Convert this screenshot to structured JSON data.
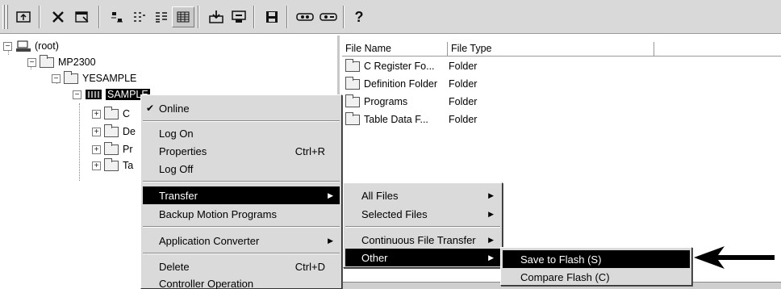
{
  "toolbar": {
    "icons": [
      "up-folder-icon",
      "delete-icon",
      "properties-icon",
      "large-icons-view-icon",
      "small-icons-view-icon",
      "list-view-icon",
      "details-view-icon",
      "download-icon",
      "upload-icon",
      "save-icon",
      "connect-icon",
      "disconnect-icon",
      "help-icon"
    ]
  },
  "tree": {
    "root": "(root)",
    "controller": "MP2300",
    "project": "YESAMPLE",
    "selected": "SAMPLE",
    "children": [
      "C",
      "De",
      "Pr",
      "Ta"
    ]
  },
  "filelist": {
    "columns": [
      "File Name",
      "File Type"
    ],
    "rows": [
      {
        "name": "C Register Fo...",
        "type": "Folder"
      },
      {
        "name": "Definition Folder",
        "type": "Folder"
      },
      {
        "name": "Programs",
        "type": "Folder"
      },
      {
        "name": "Table Data F...",
        "type": "Folder"
      }
    ]
  },
  "context_menu": {
    "online": "Online",
    "log_on": "Log On",
    "properties": "Properties",
    "properties_shortcut": "Ctrl+R",
    "log_off": "Log Off",
    "transfer": "Transfer",
    "backup": "Backup Motion Programs",
    "app_converter": "Application Converter",
    "delete": "Delete",
    "delete_shortcut": "Ctrl+D",
    "controller_op": "Controller Operation"
  },
  "transfer_menu": {
    "all_files": "All Files",
    "selected_files": "Selected Files",
    "continuous": "Continuous File Transfer",
    "other": "Other"
  },
  "other_menu": {
    "save_flash": "Save to Flash (S)",
    "compare_flash": "Compare Flash (C)"
  }
}
